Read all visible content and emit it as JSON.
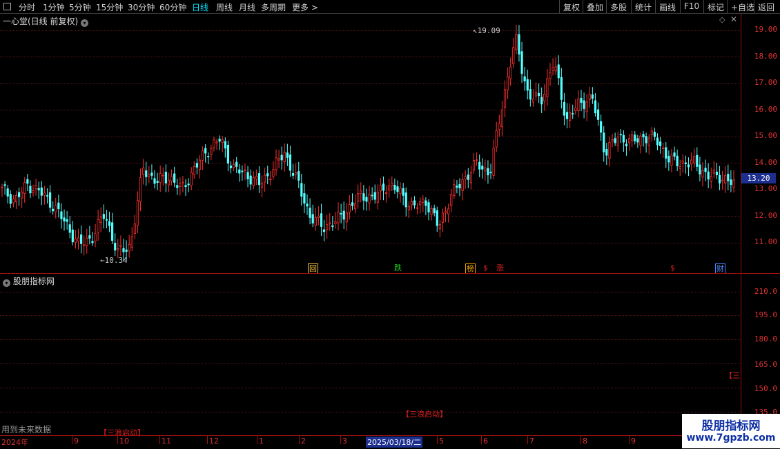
{
  "toolbar": {
    "periods": [
      "分时",
      "1分钟",
      "5分钟",
      "15分钟",
      "30分钟",
      "60分钟",
      "日线",
      "周线",
      "月线",
      "多周期",
      "更多 >"
    ],
    "active_period": "日线",
    "actions": [
      "复权",
      "叠加",
      "多股",
      "统计",
      "画线",
      "F10",
      "标记",
      "+自选",
      "返回"
    ]
  },
  "main_panel": {
    "title": "一心堂(日线 前复权)",
    "y_ticks": [
      "19.00",
      "18.00",
      "17.00",
      "16.00",
      "15.00",
      "14.00",
      "13.00",
      "12.00",
      "11.00"
    ],
    "current_price": "13.20",
    "high_label": "19.09",
    "low_label": "10.34",
    "event_marks": [
      {
        "text": "回",
        "color": "#f0c040",
        "boxed": true
      },
      {
        "text": "跌",
        "color": "#20d020",
        "boxed": false
      },
      {
        "text": "榜",
        "color": "#f0a000",
        "boxed": true
      },
      {
        "text": "$",
        "color": "#e02020",
        "boxed": false
      },
      {
        "text": "涨",
        "color": "#e02020",
        "boxed": false
      },
      {
        "text": "$",
        "color": "#e02020",
        "boxed": false
      },
      {
        "text": "财",
        "color": "#4a8aff",
        "boxed": true
      }
    ]
  },
  "indicator_panel": {
    "title": "股朋指标网",
    "y_ticks": [
      "210.0",
      "195.0",
      "180.0",
      "165.0",
      "150.0",
      "135.0"
    ],
    "signals": [
      "【三浪启动】",
      "【三浪启动】",
      "【三"
    ],
    "note": "用到未来数据"
  },
  "time_axis": {
    "labels": [
      "2024年",
      "9",
      "10",
      "11",
      "12",
      "1",
      "2",
      "3",
      "2025/03/18/二",
      "5",
      "6",
      "7",
      "8",
      "9"
    ],
    "selected": "2025/03/18/二"
  },
  "watermark": {
    "line1": "股朋指标网",
    "line2": "www.7gpzb.com"
  },
  "chart_data": {
    "type": "candlestick",
    "ylim": [
      10.0,
      19.3
    ],
    "months": [
      "2024-08",
      "2024-09",
      "2024-10",
      "2024-11",
      "2024-12",
      "2025-01",
      "2025-02",
      "2025-03",
      "2025-04",
      "2025-05",
      "2025-06",
      "2025-07",
      "2025-08",
      "2025-09"
    ],
    "close_path": [
      13.0,
      12.6,
      13.2,
      12.9,
      12.4,
      11.7,
      10.9,
      11.2,
      12.1,
      10.6,
      10.9,
      13.8,
      13.3,
      13.5,
      13.0,
      13.8,
      14.5,
      14.9,
      13.8,
      13.6,
      13.2,
      13.7,
      14.4,
      13.3,
      12.0,
      11.6,
      11.8,
      12.3,
      12.8,
      12.7,
      13.2,
      12.9,
      12.3,
      12.6,
      11.6,
      12.8,
      13.4,
      14.0,
      13.6,
      16.3,
      18.7,
      16.5,
      16.4,
      17.8,
      15.6,
      16.3,
      16.4,
      14.4,
      15.0,
      14.8,
      15.0,
      14.9,
      14.1,
      14.0,
      14.0,
      13.5,
      13.5,
      13.2
    ],
    "high": 19.09,
    "low": 10.34,
    "last": 13.2
  },
  "colors": {
    "up": "#ff3030",
    "down": "#54ffff",
    "axis": "#d33",
    "grid": "#551515",
    "background": "#000000"
  }
}
